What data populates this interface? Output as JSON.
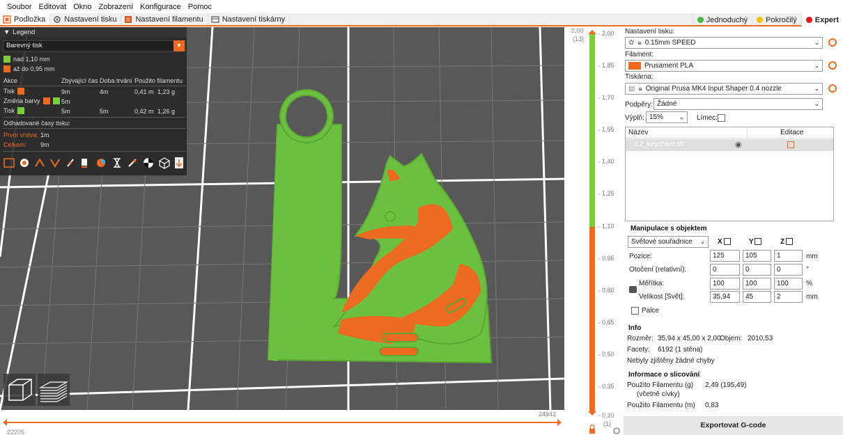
{
  "menu": [
    "Soubor",
    "Editovat",
    "Okno",
    "Zobrazení",
    "Konfigurace",
    "Pomoc"
  ],
  "tabs": [
    {
      "label": "Podložka",
      "active": true
    },
    {
      "label": "Nastavení tisku",
      "active": false
    },
    {
      "label": "Nastavení filamentu",
      "active": false
    },
    {
      "label": "Nastavení tiskárny",
      "active": false
    }
  ],
  "modes": [
    {
      "label": "Jednoduchý",
      "color": "#44bb44"
    },
    {
      "label": "Pokročilý",
      "color": "#f2c100"
    },
    {
      "label": "Expert",
      "color": "#e01919"
    }
  ],
  "legend": {
    "title": "Legend",
    "view_type": "Barevný tisk",
    "items": [
      {
        "label": "nad 1,10 mm",
        "color": "#7bcf3a"
      },
      {
        "label": "až do 0,95 mm",
        "color": "#ed6b21"
      }
    ],
    "columns": [
      "Akce",
      "Zbývající čas",
      "Doba trvání",
      "Použito filamentu"
    ],
    "rows": [
      {
        "action": "Tisk",
        "remaining": "9m",
        "duration": "4m",
        "used_m": "0,41 m",
        "used_g": "1,23 g"
      },
      {
        "action": "Změna barvy",
        "remaining": "5m",
        "duration": "",
        "used_m": "",
        "used_g": ""
      },
      {
        "action": "Tisk",
        "remaining": "5m",
        "duration": "5m",
        "used_m": "0,42 m",
        "used_g": "1,26 g"
      }
    ],
    "estimated_title": "Odhadované časy tisku:",
    "first_layer_label": "První vrstva:",
    "first_layer_value": "1m",
    "total_label": "Celkem:",
    "total_value": "9m"
  },
  "slider": {
    "top_value": "2,00",
    "top_layer": "(13)",
    "bottom_value": "0,20",
    "bottom_layer": "(1)",
    "ticks": [
      "2,00",
      "1,85",
      "1,70",
      "1,55",
      "1,40",
      "1,25",
      "1,10",
      "0,95",
      "0,80",
      "0,65",
      "0,50",
      "0,35",
      "0,20"
    ],
    "h_left": "22205",
    "h_right": "24942"
  },
  "right": {
    "print_settings_label": "Nastavení tisku:",
    "print_settings_value": "0.15mm SPEED",
    "filament_label": "Filament:",
    "filament_value": "Prusament PLA",
    "filament_color": "#ed6b21",
    "printer_label": "Tiskárna:",
    "printer_value": "Original Prusa MK4 Input Shaper 0.4 nozzle",
    "supports_label": "Podpěry:",
    "supports_value": "Žádné",
    "infill_label": "Výplň:",
    "infill_value": "15%",
    "brim_label": "Límec:",
    "object_list_headers": [
      "Název",
      "Editace"
    ],
    "object_name": "L2_keycham.stl",
    "manip_title": "Manipulace s objektem",
    "coord_system": "Světové souřadnice",
    "axes": [
      "X",
      "Y",
      "Z"
    ],
    "position_label": "Pozice:",
    "position": [
      "125",
      "105",
      "1"
    ],
    "rotation_label": "Otočení (relativní):",
    "rotation": [
      "0",
      "0",
      "0"
    ],
    "scale_label": "Měřítka:",
    "scale": [
      "100",
      "100",
      "100"
    ],
    "size_label": "Velikost [Svět]:",
    "size": [
      "35,94",
      "45",
      "2"
    ],
    "unit_mm": "mm",
    "unit_deg": "°",
    "unit_pct": "%",
    "inches_label": "Palce",
    "info_title": "Info",
    "size_info_label": "Rozměr:",
    "size_info_value": "35,94 x 45,00 x 2,00",
    "volume_label": "Objem:",
    "volume_value": "2010,53",
    "facets_label": "Facety:",
    "facets_value": "6192 (1 stěna)",
    "errors_text": "Nebyly zjištěny žádné chyby",
    "slicing_title": "Informace o slicování",
    "used_g_label": "Použito Filamentu (g)",
    "used_g_sub": "(včetně cívky)",
    "used_g_value": "2,49 (195,49)",
    "used_m_label": "Použito Filamentu (m)",
    "used_m_value": "0,83",
    "export_label": "Exportovat G-code"
  }
}
